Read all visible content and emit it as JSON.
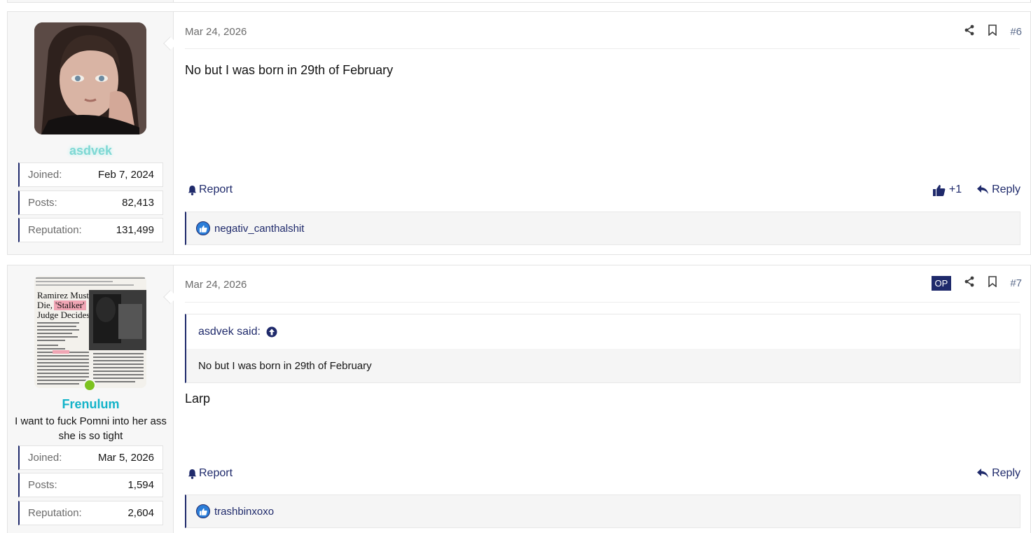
{
  "posts": [
    {
      "author": {
        "name": "asdvek",
        "name_color": "#7fd8d4",
        "title": ""
      },
      "stats": [
        {
          "label": "Joined:",
          "value": "Feb 7, 2024"
        },
        {
          "label": "Posts:",
          "value": "82,413"
        },
        {
          "label": "Reputation:",
          "value": "131,499"
        }
      ],
      "date": "Mar 24, 2026",
      "number": "#6",
      "op_badge": "",
      "content": "No but I was born in 29th of February",
      "report_label": "Report",
      "like_count": "+1",
      "reply_label": "Reply",
      "reactions": "negativ_canthalshit"
    },
    {
      "author": {
        "name": "Frenulum",
        "name_color": "#13b3c9",
        "title": "I want to fuck Pomni into her ass she is so tight"
      },
      "stats": [
        {
          "label": "Joined:",
          "value": "Mar 5, 2026"
        },
        {
          "label": "Posts:",
          "value": "1,594"
        },
        {
          "label": "Reputation:",
          "value": "2,604"
        }
      ],
      "date": "Mar 24, 2026",
      "number": "#7",
      "op_badge": "OP",
      "quote": {
        "author": "asdvek said:",
        "text": "No but I was born in 29th of February"
      },
      "content": "Larp",
      "report_label": "Report",
      "reply_label": "Reply",
      "reactions": "trashbinxoxo",
      "avatar_text": {
        "headline": "Ramirez Must Die, 'Stalker' Judge Decides"
      }
    }
  ]
}
